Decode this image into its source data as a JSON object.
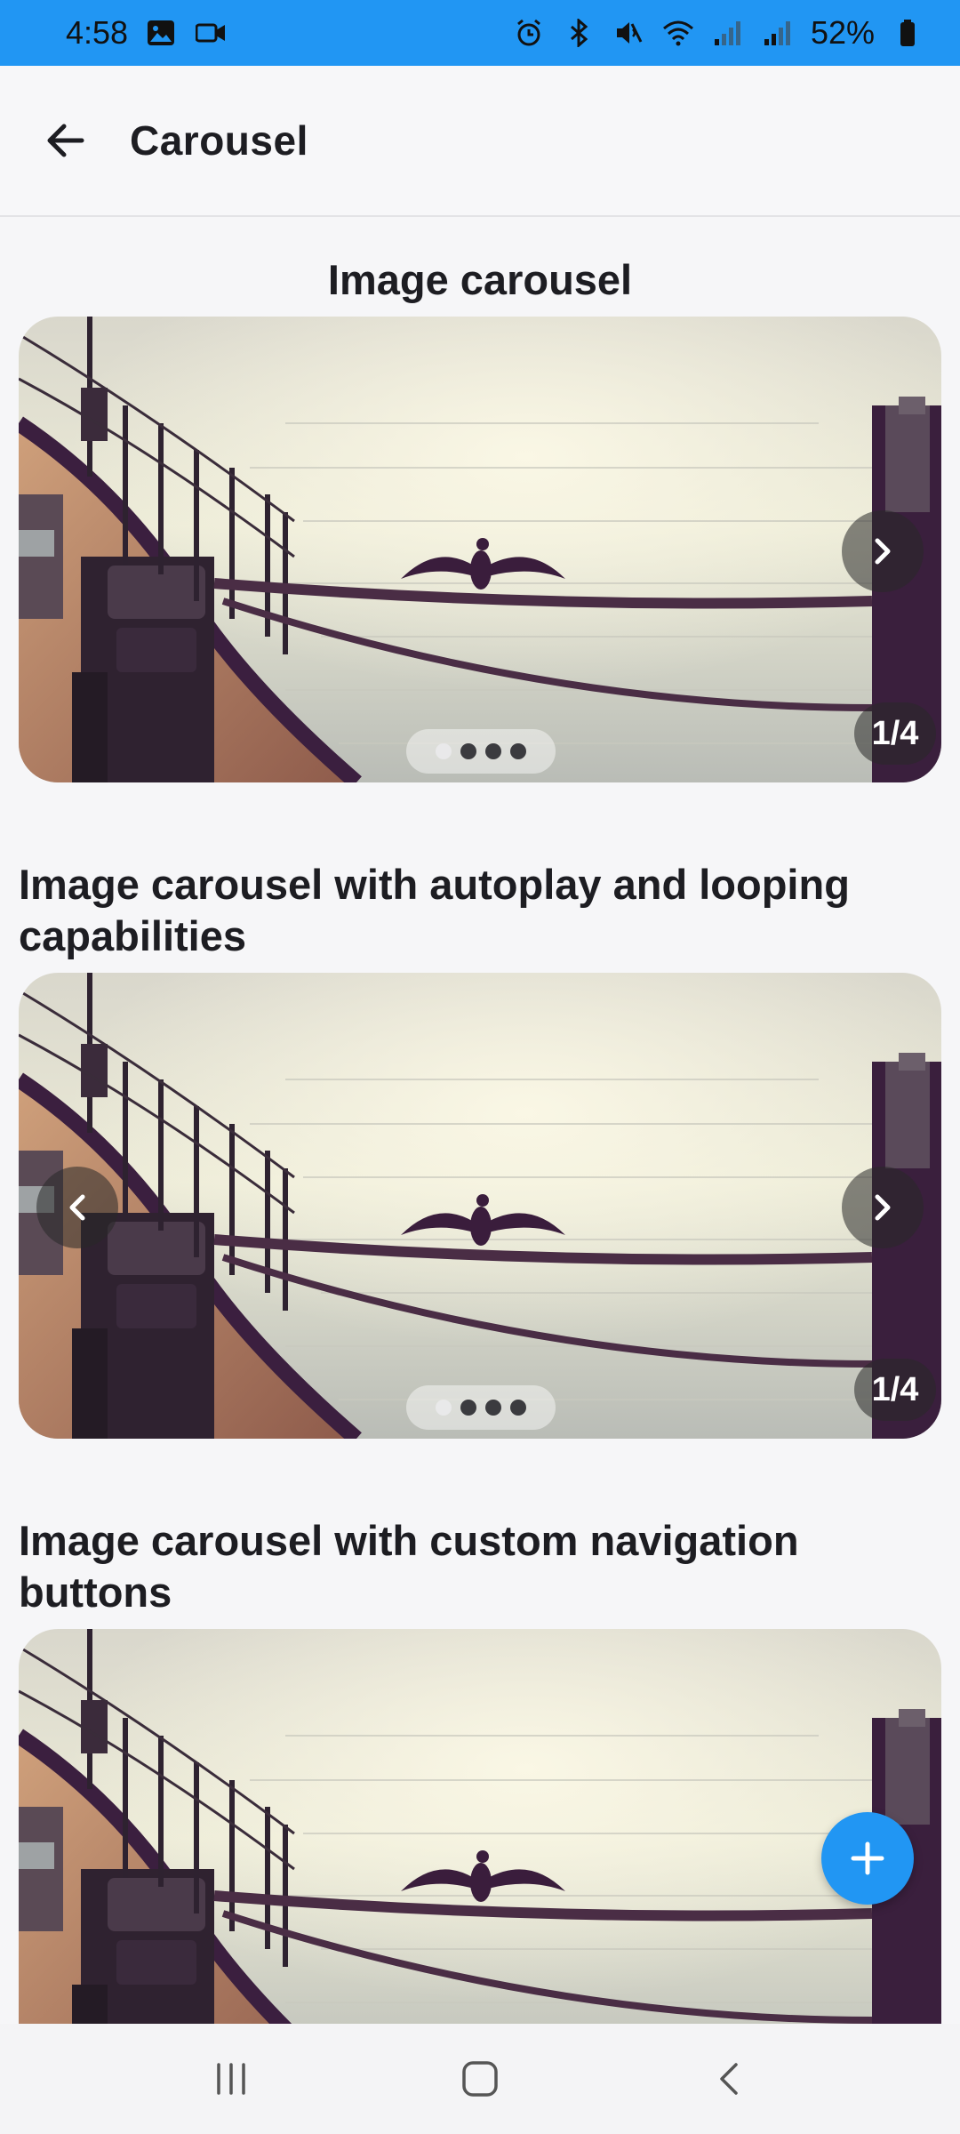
{
  "status_bar": {
    "time": "4:58",
    "battery": "52%"
  },
  "app_bar": {
    "title": "Carousel"
  },
  "sections": [
    {
      "title": "Image carousel",
      "counter": "1/4",
      "has_prev": false,
      "has_next": true,
      "dots": 4,
      "active_dot": 0
    },
    {
      "title": "Image carousel with autoplay and looping capabilities",
      "counter": "1/4",
      "has_prev": true,
      "has_next": true,
      "dots": 4,
      "active_dot": 0
    },
    {
      "title": "Image carousel with custom navigation buttons"
    }
  ],
  "colors": {
    "accent": "#2196f3"
  },
  "icons": {
    "back": "arrow-left-icon",
    "next": "chevron-right-icon",
    "prev": "chevron-left-icon",
    "fab": "plus-icon"
  }
}
